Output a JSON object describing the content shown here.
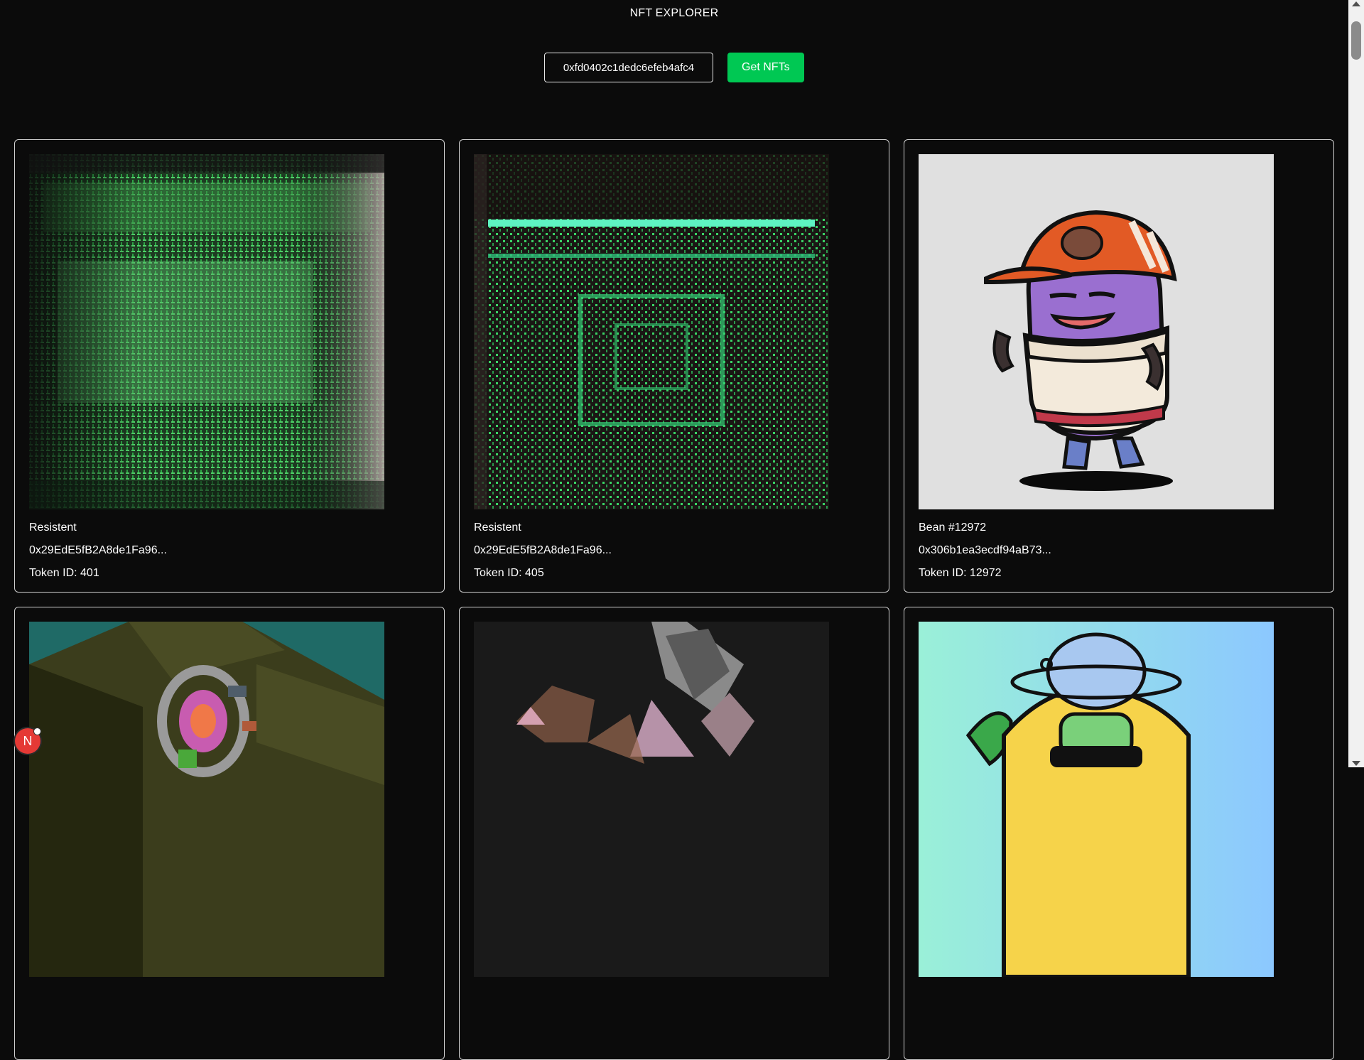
{
  "app": {
    "title": "NFT EXPLORER"
  },
  "controls": {
    "address_value": "0xfd0402c1dedc6efeb4afc4",
    "button_label": "Get NFTs"
  },
  "colors": {
    "background": "#0b0b0b",
    "accent_button": "#00c853",
    "card_border": "#d0d0d0",
    "badge": "#e53935"
  },
  "nfts": [
    {
      "name": "Resistent",
      "contract": "0x29EdE5fB2A8de1Fa96...",
      "token_id": "Token ID: 401",
      "image": "green-glitch-grid-art"
    },
    {
      "name": "Resistent",
      "contract": "0x29EdE5fB2A8de1Fa96...",
      "token_id": "Token ID: 405",
      "image": "green-matrix-circuit-art"
    },
    {
      "name": "Bean #12972",
      "contract": "0x306b1ea3ecdf94aB73...",
      "token_id": "Token ID: 12972",
      "image": "purple-bean-character-cap"
    },
    {
      "name": "",
      "contract": "",
      "token_id": "",
      "image": "isometric-voxel-portal"
    },
    {
      "name": "",
      "contract": "",
      "token_id": "",
      "image": "crystal-rock-shards"
    },
    {
      "name": "",
      "contract": "",
      "token_id": "",
      "image": "pineapple-character-sunglasses"
    }
  ],
  "dev_badge": {
    "label": "N"
  }
}
